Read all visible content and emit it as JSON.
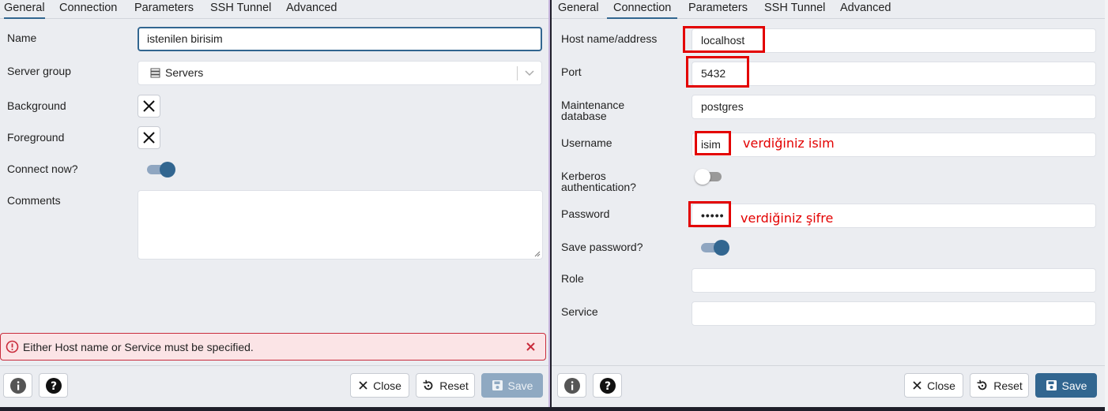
{
  "left_dialog": {
    "tabs": [
      "General",
      "Connection",
      "Parameters",
      "SSH Tunnel",
      "Advanced"
    ],
    "active_tab": "General",
    "fields": {
      "name_label": "Name",
      "name_value": "istenilen birisim",
      "server_group_label": "Server group",
      "server_group_value": "Servers",
      "background_label": "Background",
      "foreground_label": "Foreground",
      "connect_now_label": "Connect now?",
      "connect_now": true,
      "comments_label": "Comments",
      "comments_value": ""
    },
    "error_message": "Either Host name or Service must be specified.",
    "buttons": {
      "close": "Close",
      "reset": "Reset",
      "save": "Save"
    }
  },
  "right_dialog": {
    "tabs": [
      "General",
      "Connection",
      "Parameters",
      "SSH Tunnel",
      "Advanced"
    ],
    "active_tab": "Connection",
    "fields": {
      "host_label": "Host name/address",
      "host_value": "localhost",
      "port_label": "Port",
      "port_value": "5432",
      "maintenance_label_1": "Maintenance",
      "maintenance_label_2": "database",
      "maintenance_value": "postgres",
      "username_label": "Username",
      "username_value": "isim",
      "kerberos_label_1": "Kerberos",
      "kerberos_label_2": "authentication?",
      "kerberos": false,
      "password_label": "Password",
      "password_value": "•••••",
      "save_password_label": "Save password?",
      "save_password": true,
      "role_label": "Role",
      "role_value": "",
      "service_label": "Service",
      "service_value": ""
    },
    "buttons": {
      "close": "Close",
      "reset": "Reset",
      "save": "Save"
    }
  },
  "annotations": {
    "username_note": "verdiğiniz isim",
    "password_note": "verdiğiniz şifre"
  },
  "colors": {
    "accent": "#326690",
    "error": "#c92c3c",
    "annotation": "#e30000"
  }
}
